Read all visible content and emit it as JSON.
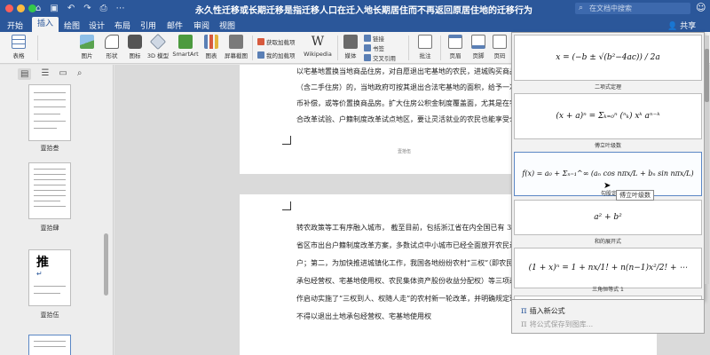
{
  "window": {
    "title": "永久性迁移或长期迁移是指迁移人口在迁入地长期居住而不再返回原居住地的迁移行为",
    "search_placeholder": "在文档中搜索",
    "titlebar_color": "#2b579a",
    "traffic_lights": [
      "#fc605b",
      "#fdbc40",
      "#34c84a"
    ],
    "qat_icons": [
      "home-icon",
      "save-icon",
      "undo-icon",
      "redo-icon",
      "print-icon",
      "more-icon"
    ]
  },
  "tabs": [
    {
      "label": "开始"
    },
    {
      "label": "插入"
    },
    {
      "label": "绘图"
    },
    {
      "label": "设计"
    },
    {
      "label": "布局"
    },
    {
      "label": "引用"
    },
    {
      "label": "邮件"
    },
    {
      "label": "审阅"
    },
    {
      "label": "视图"
    }
  ],
  "share_label": "共享",
  "ribbon": {
    "table": "表格",
    "pictures": "图片",
    "shapes": "形状",
    "icons": "图标",
    "models_3d": "3D 模型",
    "smartart": "SmartArt",
    "chart": "图表",
    "screenshot": "屏幕截图",
    "get_addins": "获取加载项",
    "my_addins": "我的加载项",
    "wikipedia": "Wikipedia",
    "media": "媒体",
    "link": "链接",
    "bookmark": "书签",
    "cross_reference": "交叉引用",
    "comment": "批注",
    "header": "页眉",
    "footer": "页脚",
    "page_number": "页码",
    "textbox": "文本框",
    "wordart": "艺术字",
    "equation_glyph": "π",
    "symbol_glyph": "Ω"
  },
  "sidebar": {
    "tool_icons": [
      "thumbnails-icon",
      "outline-icon",
      "comments-icon",
      "search-icon"
    ],
    "pages": [
      {
        "label": "壹拾叁"
      },
      {
        "label": "壹拾肆"
      },
      {
        "label": "壹拾伍"
      },
      {
        "label": ""
      }
    ],
    "big_char": "推"
  },
  "document": {
    "page1_lines": [
      "以宅基地置换当地商品住房，对自愿退出宅基地的农民，进城购买商品住房",
      "（含二手住房）的，当地政府可按其退出合法宅基地的面积，给予一次性货",
      "币补偿，或等价置换商品房。扩大住房公积金制度覆盖面，尤其是在农村制度",
      "合改革试验、户籍制度改革试点地区，要让灵活就业的农民也能享受公积金"
    ],
    "page1_footer": "壹拾伍",
    "page2_lines": [
      "转农政策等工有序融入城市，  截至目前，包括浙江省在内全国已有 30 多个",
      "省区市出台户籍制度改革方案，多数试点中小城市已经全面放开农民进城落",
      "户；第二，为加快推进城镇化工作，我国各地纷纷农村“三权”（即农民土地",
      "承包经营权、宅基地使用权、农民集体资产股份收益分配权）等三项改革工",
      "作启动实施了“三权到人、权随人走”的农村新一轮改革，并明确规定现阶段，",
      "不得以退出土地承包经营权、宅基地使用权"
    ]
  },
  "equation_gallery": {
    "items": [
      {
        "category": "",
        "formula": "x = (−b ± √(b²−4ac)) / 2a"
      },
      {
        "category": "二项式定理",
        "formula": "(x + a)ⁿ = Σₖ₌₀ⁿ (ⁿₖ) xᵏ aⁿ⁻ᵏ"
      },
      {
        "category": "傅立叶级数",
        "formula": "f(x) = a₀ + Σₙ₌₁^∞ (aₙ cos nπx/L + bₙ sin nπx/L)"
      },
      {
        "category": "勾股定理",
        "formula": "a² + b²"
      },
      {
        "category": "和的展开式",
        "formula": "(1 + x)ⁿ = 1 + nx/1! + n(n−1)x²/2! + ⋯"
      },
      {
        "category": "三角恒等式 1",
        "formula": ""
      }
    ],
    "tooltip": "傅立叶级数",
    "insert_new": "插入新公式",
    "save_selection": "将公式保存到图库..."
  }
}
